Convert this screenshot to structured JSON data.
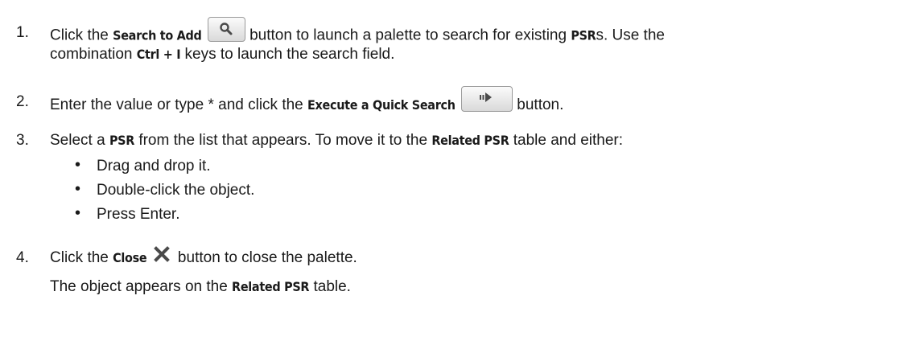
{
  "steps": [
    {
      "num": "1.",
      "line1": {
        "t1": "Click the ",
        "b1": "Search to Add",
        "t2": " button to launch a palette to search for existing ",
        "b2": "PSR",
        "t3": "s. Use the"
      },
      "line2": {
        "t1": "combination ",
        "b1": "Ctrl + I",
        "t2": " keys to launch the search field."
      }
    },
    {
      "num": "2.",
      "line1": {
        "t1": "Enter the value or type * and click the ",
        "b1": "Execute a Quick Search",
        "t2": " button."
      }
    },
    {
      "num": "3.",
      "line1": {
        "t1": "Select a ",
        "b1": "PSR",
        "t2": " from the list that appears. To move it to the ",
        "b2": "Related PSR",
        "t3": " table and either:"
      },
      "bullets": [
        "Drag and drop it.",
        "Double-click the object.",
        "Press Enter."
      ]
    },
    {
      "num": "4.",
      "line1": {
        "t1": "Click the ",
        "b1": "Close",
        "t2": " button to close the palette."
      },
      "result": {
        "t1": "The object appears on the ",
        "b1": "Related PSR",
        "t2": " table."
      }
    }
  ],
  "bullet_char": "•",
  "icons": {
    "search": "magnifier-icon",
    "execute": "arrow-right-icon",
    "close": "close-x-icon"
  },
  "colors": {
    "text": "#1a1a1a",
    "button_border": "#9a9a9a",
    "icon": "#4a4a4a"
  }
}
